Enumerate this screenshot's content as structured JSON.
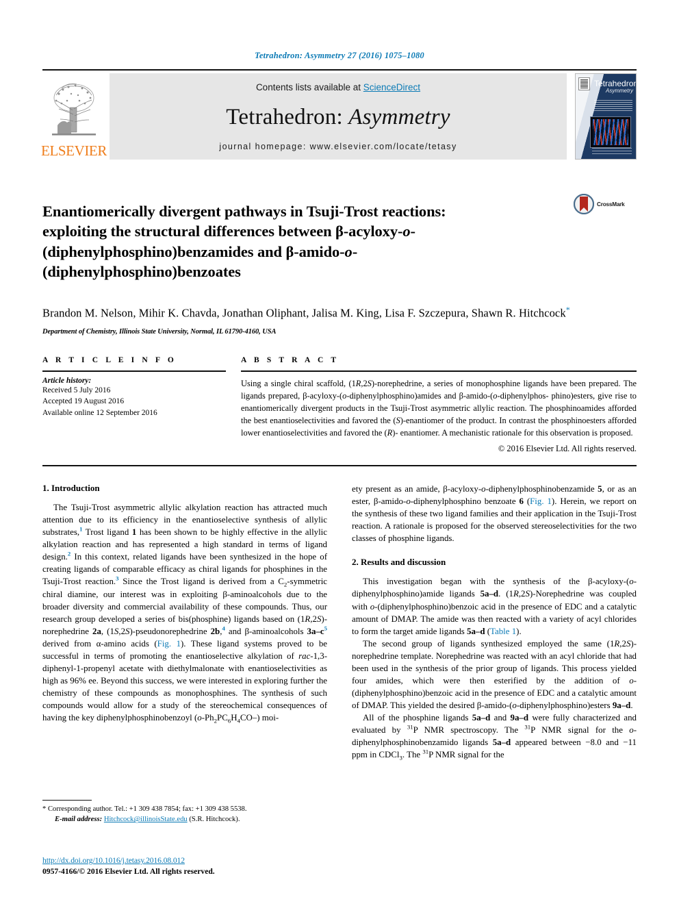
{
  "running_head": "Tetrahedron: Asymmetry 27 (2016) 1075–1080",
  "masthead": {
    "contents_prefix": "Contents lists available at ",
    "sciencedirect": "ScienceDirect",
    "journal_title_main": "Tetrahedron: ",
    "journal_title_italic": "Asymmetry",
    "homepage": "journal homepage: www.elsevier.com/locate/tetasy",
    "publisher_wordmark": "ELSEVIER",
    "cover_title": "Tetrahedron:",
    "cover_subtitle": "Asymmetry"
  },
  "article": {
    "title_line1": "Enantiomerically divergent pathways in Tsuji-Trost reactions:",
    "title_line2_a": "exploiting the structural differences between β-acyloxy-",
    "title_line2_o": "o",
    "title_line2_b": "-",
    "title_line3_a": "(diphenylphosphino)benzamides and β-amido-",
    "title_line3_o": "o",
    "title_line3_b": "-",
    "title_line4": "(diphenylphosphino)benzoates",
    "crossmark_label": "CrossMark",
    "authors": "Brandon M. Nelson, Mihir K. Chavda, Jonathan Oliphant, Jalisa M. King, Lisa F. Szczepura, Shawn R. Hitchcock",
    "corresponding_marker": "*",
    "affiliation": "Department of Chemistry, Illinois State University, Normal, IL 61790-4160, USA"
  },
  "article_info": {
    "heading": "A R T I C L E   I N F O",
    "history_label": "Article history:",
    "history": [
      "Received 5 July 2016",
      "Accepted 19 August 2016",
      "Available online 12 September 2016"
    ]
  },
  "abstract": {
    "heading": "A B S T R A C T",
    "body": "Using a single chiral scaffold, (1R,2S)-norephedrine, a series of monophosphine ligands have been prepared. The ligands prepared, β-acyloxy-(o-diphenylphosphino)amides and β-amido-(o-diphenylphos-phino)esters, give rise to enantiomerically divergent products in the Tsuji-Trost asymmetric allylic reaction. The phosphinoamides afforded the best enantioselectivities and favored the (S)-enantiomer of the product. In contrast the phosphinoesters afforded lower enantioselectivities and favored the (R)-enantiomer. A mechanistic rationale for this observation is proposed.",
    "copyright": "© 2016 Elsevier Ltd. All rights reserved."
  },
  "sections": {
    "introduction_heading": "1. Introduction",
    "results_heading": "2. Results and discussion"
  },
  "left_column": {
    "intro_p1": "The Tsuji-Trost asymmetric allylic alkylation reaction has attracted much attention due to its efficiency in the enantioselective synthesis of allylic substrates,1 Trost ligand 1 has been shown to be highly effective in the allylic alkylation reaction and has represented a high standard in terms of ligand design.2 In this context, related ligands have been synthesized in the hope of creating ligands of comparable efficacy as chiral ligands for phosphines in the Tsuji-Trost reaction.3 Since the Trost ligand is derived from a C2-symmetric chiral diamine, our interest was in exploiting β-aminoalcohols due to the broader diversity and commercial availability of these compounds. Thus, our research group developed a series of bis(phosphine) ligands based on (1R,2S)-norephedrine 2a, (1S,2S)-pseudonorephedrine 2b,4 and β-aminoalcohols 3a–c5 derived from α-amino acids (Fig. 1). These ligand systems proved to be successful in terms of promoting the enantioselective alkylation of rac-1,3-diphenyl-1-propenyl acetate with diethylmalonate with enantioselectivities as high as 96% ee. Beyond this success, we were interested in exploring further the chemistry of these compounds as monophosphines. The synthesis of such compounds would allow for a study of the stereochemical consequences of having the key diphenylphosphinobenzoyl (o-Ph2PC6H4CO–) moi-"
  },
  "right_column": {
    "intro_p1_cont": "ety present as an amide, β-acyloxy-o-diphenylphosphinobenzamide 5, or as an ester, β-amido-o-diphenylphosphino benzoate 6 (Fig. 1). Herein, we report on the synthesis of these two ligand families and their application in the Tsuji-Trost reaction. A rationale is proposed for the observed stereoselectivities for the two classes of phosphine ligands.",
    "results_p1": "This investigation began with the synthesis of the β-acyloxy-(o-diphenylphosphino)amide ligands 5a–d. (1R,2S)-Norephedrine was coupled with o-(diphenylphosphino)benzoic acid in the presence of EDC and a catalytic amount of DMAP. The amide was then reacted with a variety of acyl chlorides to form the target amide ligands 5a–d (Table 1).",
    "results_p2": "The second group of ligands synthesized employed the same (1R,2S)-norephedrine template. Norephedrine was reacted with an acyl chloride that had been used in the synthesis of the prior group of ligands. This process yielded four amides, which were then esterified by the addition of o-(diphenylphosphino)benzoic acid in the presence of EDC and a catalytic amount of DMAP. This yielded the desired β-amido-(o-diphenylphosphino)esters 9a–d.",
    "results_p3": "All of the phosphine ligands 5a–d and 9a–d were fully characterized and evaluated by 31P NMR spectroscopy. The 31P NMR signal for the o-diphenylphosphinobenzamido ligands 5a–d appeared between −8.0 and −11 ppm in CDCl3. The 31P NMR signal for the"
  },
  "footnote": {
    "marker": "*",
    "line1": "Corresponding author. Tel.: +1 309 438 7854; fax: +1 309 438 5538.",
    "email_label": "E-mail address:",
    "email": "Hitchcock@illinoisState.edu",
    "email_suffix": "(S.R. Hitchcock)."
  },
  "page_footer": {
    "doi": "http://dx.doi.org/10.1016/j.tetasy.2016.08.012",
    "issn": "0957-4166/© 2016 Elsevier Ltd. All rights reserved."
  },
  "colors": {
    "link": "#0b7ab5",
    "elsevier_orange": "#ef7d1a",
    "masthead_gray": "#e6e6e6"
  }
}
